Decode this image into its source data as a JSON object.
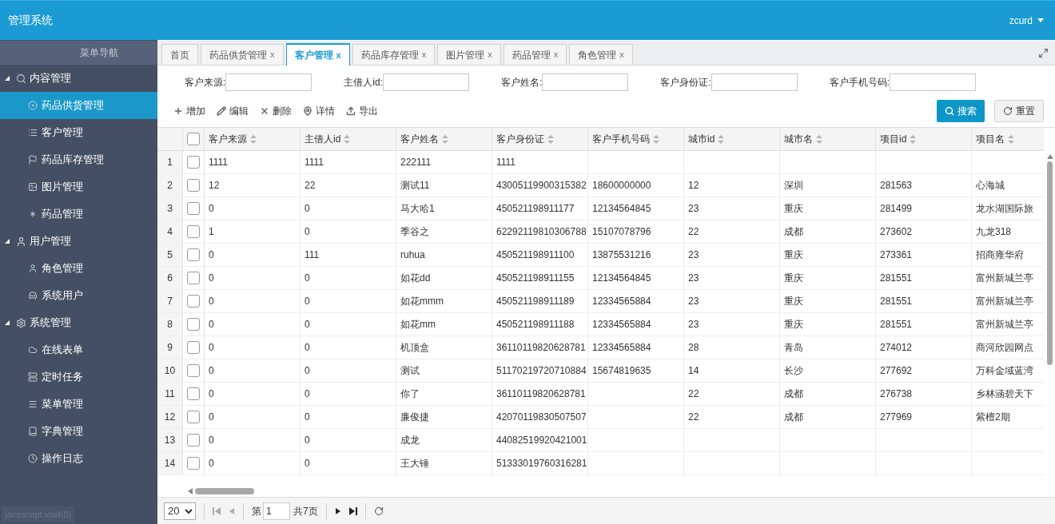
{
  "header": {
    "title": "管理系统",
    "user": "zcurd"
  },
  "sidebar": {
    "title": "菜单导航",
    "groups": [
      {
        "label": "内容管理",
        "expanded": true,
        "items": [
          {
            "label": "药品供货管理",
            "selected": true
          },
          {
            "label": "客户管理",
            "selected": false
          },
          {
            "label": "药品库存管理",
            "selected": false
          },
          {
            "label": "图片管理",
            "selected": false
          },
          {
            "label": "药品管理",
            "selected": false
          }
        ]
      },
      {
        "label": "用户管理",
        "expanded": true,
        "items": [
          {
            "label": "角色管理",
            "selected": false
          },
          {
            "label": "系统用户",
            "selected": false
          }
        ]
      },
      {
        "label": "系统管理",
        "expanded": true,
        "items": [
          {
            "label": "在线表单",
            "selected": false
          },
          {
            "label": "定时任务",
            "selected": false
          },
          {
            "label": "菜单管理",
            "selected": false
          },
          {
            "label": "字典管理",
            "selected": false
          },
          {
            "label": "操作日志",
            "selected": false
          }
        ]
      }
    ]
  },
  "status_text": "javascript:void(0)",
  "tabs": [
    {
      "label": "首页",
      "selected": false
    },
    {
      "label": "药品供货管理",
      "selected": false,
      "close": "x"
    },
    {
      "label": "客户管理",
      "selected": true,
      "close": "x"
    },
    {
      "label": "药品库存管理",
      "selected": false,
      "close": "x"
    },
    {
      "label": "图片管理",
      "selected": false,
      "close": "x"
    },
    {
      "label": "药品管理",
      "selected": false,
      "close": "x"
    },
    {
      "label": "角色管理",
      "selected": false,
      "close": "x"
    }
  ],
  "search_fields": [
    {
      "label": "客户来源:"
    },
    {
      "label": "主借人id:"
    },
    {
      "label": "客户姓名:"
    },
    {
      "label": "客户身份证:"
    },
    {
      "label": "客户手机号码:"
    }
  ],
  "toolbar": [
    "增加",
    "编辑",
    "删除",
    "详情",
    "导出"
  ],
  "buttons": {
    "search": "搜索",
    "reset": "重置"
  },
  "table": {
    "all_checked": false,
    "columns": [
      "客户来源",
      "主借人id",
      "客户姓名",
      "客户身份证",
      "客户手机号码",
      "城市id",
      "城市名",
      "项目id",
      "项目名"
    ],
    "rows": [
      {
        "index": "1",
        "checked": false,
        "cells": [
          "1111",
          "1111",
          "222111",
          "1111",
          "",
          "",
          "",
          "",
          ""
        ]
      },
      {
        "index": "2",
        "checked": false,
        "cells": [
          "12",
          "22",
          "测试11",
          "43005119900315382",
          "18600000000",
          "12",
          "深圳",
          "281563",
          "心海城"
        ]
      },
      {
        "index": "3",
        "checked": false,
        "cells": [
          "0",
          "0",
          "马大哈1",
          "450521198911177",
          "12134564845",
          "23",
          "重庆",
          "281499",
          "龙水湖国际旅"
        ]
      },
      {
        "index": "4",
        "checked": false,
        "cells": [
          "1",
          "0",
          "季谷之",
          "62292119810306788",
          "15107078796",
          "22",
          "成都",
          "273602",
          "九龙318"
        ]
      },
      {
        "index": "5",
        "checked": false,
        "cells": [
          "0",
          "111",
          "ruhua",
          "450521198911100",
          "13875531216",
          "23",
          "重庆",
          "273361",
          "招商雍华府"
        ]
      },
      {
        "index": "6",
        "checked": false,
        "cells": [
          "0",
          "0",
          "如花dd",
          "450521198911155",
          "12134564845",
          "23",
          "重庆",
          "281551",
          "富州新城兰亭"
        ]
      },
      {
        "index": "7",
        "checked": false,
        "cells": [
          "0",
          "0",
          "如花mmm",
          "450521198911189",
          "12334565884",
          "23",
          "重庆",
          "281551",
          "富州新城兰亭"
        ]
      },
      {
        "index": "8",
        "checked": false,
        "cells": [
          "0",
          "0",
          "如花mm",
          "450521198911188",
          "12334565884",
          "23",
          "重庆",
          "281551",
          "富州新城兰亭"
        ]
      },
      {
        "index": "9",
        "checked": false,
        "cells": [
          "0",
          "0",
          "机顶盒",
          "36110119820628781",
          "12334565884",
          "28",
          "青岛",
          "274012",
          "商河欣园网点"
        ]
      },
      {
        "index": "10",
        "checked": false,
        "cells": [
          "0",
          "0",
          "测试",
          "51170219720710884",
          "15674819635",
          "14",
          "长沙",
          "277692",
          "万科金域蓝湾"
        ]
      },
      {
        "index": "11",
        "checked": false,
        "cells": [
          "0",
          "0",
          "你了",
          "36110119820628781",
          "",
          "22",
          "成都",
          "276738",
          "乡林涵碧天下"
        ]
      },
      {
        "index": "12",
        "checked": false,
        "cells": [
          "0",
          "0",
          "廉俊捷",
          "42070119830507507",
          "",
          "22",
          "成都",
          "277969",
          "紫檀2期"
        ]
      },
      {
        "index": "13",
        "checked": false,
        "cells": [
          "0",
          "0",
          "成龙",
          "44082519920421001",
          "",
          "",
          "",
          "",
          ""
        ]
      },
      {
        "index": "14",
        "checked": false,
        "cells": [
          "0",
          "0",
          "王大锤",
          "51333019760316281",
          "",
          "",
          "",
          "",
          ""
        ]
      }
    ]
  },
  "pager": {
    "page_size": "20",
    "page_prefix": "第",
    "page": "1",
    "total": "共7页"
  }
}
